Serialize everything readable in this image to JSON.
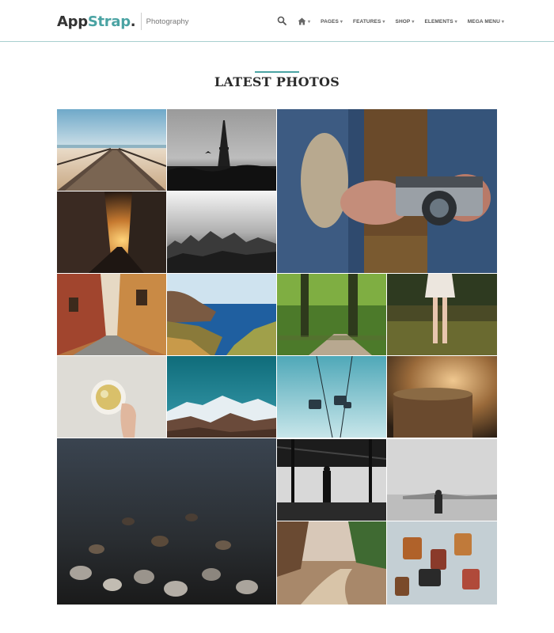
{
  "brand": {
    "name_main": "App",
    "name_accent": "Strap",
    "name_dot": ".",
    "tagline": "Photography"
  },
  "nav": {
    "items": [
      {
        "label": "PAGES"
      },
      {
        "label": "FEATURES"
      },
      {
        "label": "SHOP"
      },
      {
        "label": "ELEMENTS"
      },
      {
        "label": "MEGA MENU"
      }
    ],
    "caret": "▾"
  },
  "section": {
    "title": "LATEST PHOTOS"
  },
  "colors": {
    "accent": "#4aa3a3",
    "title": "#2b2b2b",
    "header_border": "#a8cfcf"
  },
  "photos": [
    {
      "subject": "pier"
    },
    {
      "subject": "eiffel-tower"
    },
    {
      "subject": "camera-hands"
    },
    {
      "subject": "city-street-sunset"
    },
    {
      "subject": "city-skyline-fog"
    },
    {
      "subject": "old-town-alley"
    },
    {
      "subject": "coastal-cliffs"
    },
    {
      "subject": "forest-road"
    },
    {
      "subject": "woman-in-field"
    },
    {
      "subject": "tea-cup"
    },
    {
      "subject": "snowy-mountains"
    },
    {
      "subject": "cable-cars"
    },
    {
      "subject": "tree-stump-sunset"
    },
    {
      "subject": "river-stones"
    },
    {
      "subject": "man-in-station"
    },
    {
      "subject": "man-on-beach"
    },
    {
      "subject": "forest-path"
    },
    {
      "subject": "love-padlocks"
    }
  ]
}
